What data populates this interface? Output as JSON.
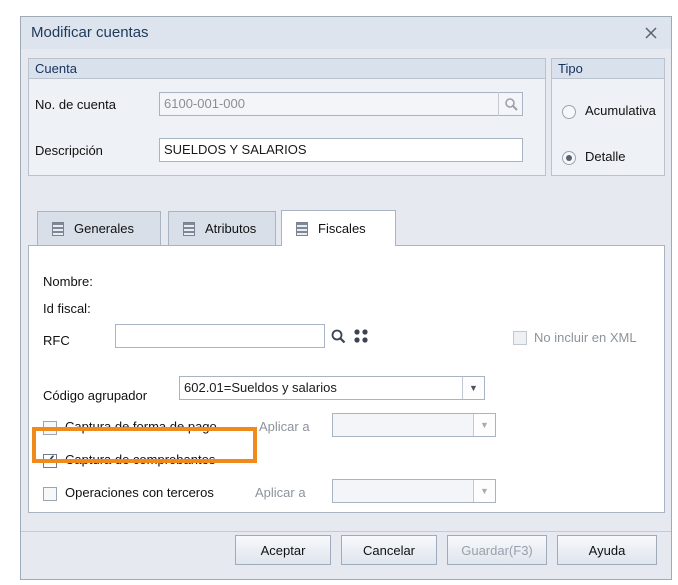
{
  "window": {
    "title": "Modificar cuentas"
  },
  "cuenta": {
    "heading": "Cuenta",
    "no_cuenta_label": "No. de cuenta",
    "no_cuenta_value": "6100-001-000",
    "descripcion_label": "Descripción",
    "descripcion_value": "SUELDOS Y SALARIOS"
  },
  "tipo": {
    "heading": "Tipo",
    "acumulativa": "Acumulativa",
    "detalle": "Detalle",
    "selected": "Detalle"
  },
  "tabs": [
    {
      "label": "Generales",
      "active": false
    },
    {
      "label": "Atributos",
      "active": false
    },
    {
      "label": "Fiscales",
      "active": true
    }
  ],
  "fiscales": {
    "nombre_label": "Nombre:",
    "id_fiscal_label": "Id fiscal:",
    "rfc_label": "RFC",
    "rfc_value": "",
    "no_incluir_label": "No incluir en XML",
    "codigo_label": "Código agrupador",
    "codigo_value": "602.01=Sueldos y salarios",
    "captura_pago_label": "Captura de forma de pago",
    "captura_pago_checked": false,
    "aplicar_a_label": "Aplicar a",
    "captura_comprobantes_label": "Captura de comprobantes",
    "captura_comprobantes_checked": true,
    "operaciones_label": "Operaciones con terceros",
    "operaciones_checked": false,
    "aplicar_a_label2": "Aplicar a"
  },
  "buttons": {
    "aceptar": "Aceptar",
    "cancelar": "Cancelar",
    "guardar": "Guardar(F3)",
    "ayuda": "Ayuda"
  },
  "colors": {
    "highlight": "#f08a1c",
    "title_text": "#1e395b"
  }
}
